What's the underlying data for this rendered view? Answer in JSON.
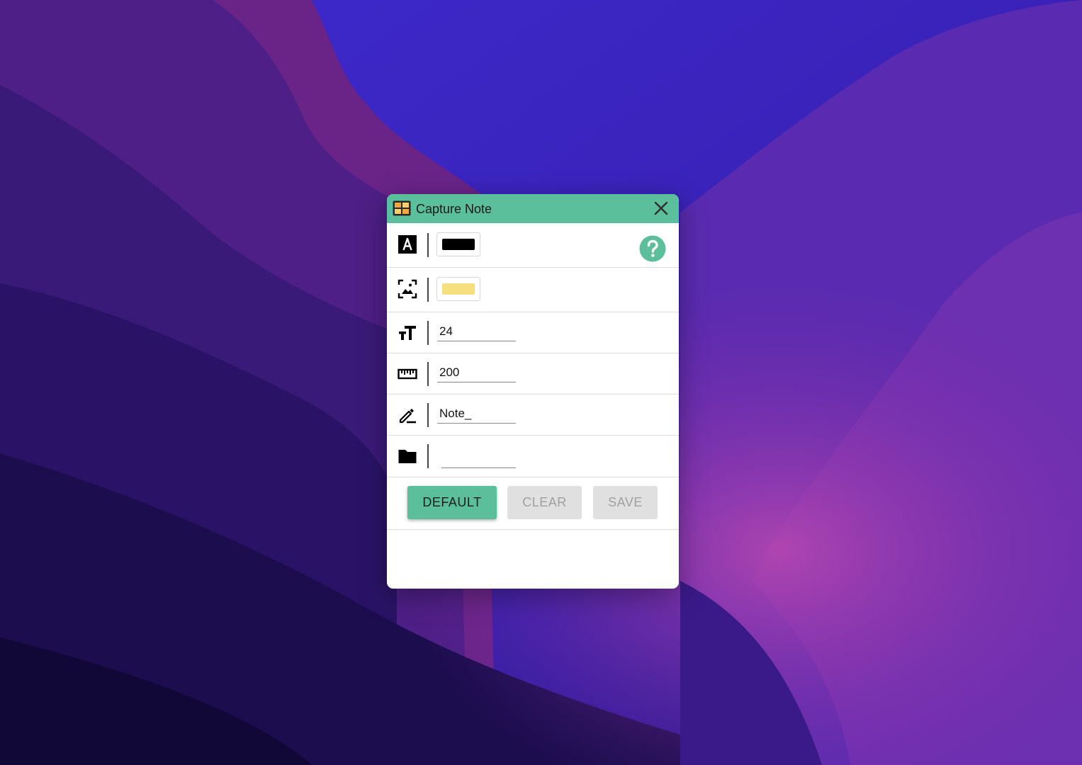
{
  "window": {
    "title": "Capture Note",
    "accent_color": "#5bbf9b"
  },
  "settings": {
    "text_color": {
      "icon": "text-color-icon",
      "value": "#000000"
    },
    "background_color": {
      "icon": "background-image-icon",
      "value": "#f5df7e"
    },
    "font_size": {
      "icon": "text-size-icon",
      "value": "24"
    },
    "width": {
      "icon": "ruler-icon",
      "value": "200"
    },
    "filename_prefix": {
      "icon": "edit-pen-icon",
      "value": "Note_"
    },
    "folder": {
      "icon": "folder-icon",
      "value": ""
    }
  },
  "buttons": {
    "default_label": "DEFAULT",
    "clear_label": "CLEAR",
    "save_label": "SAVE",
    "help_icon": "help-icon"
  }
}
